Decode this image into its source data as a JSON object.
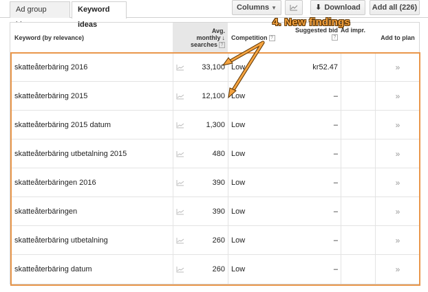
{
  "tabs": [
    {
      "label": "Ad group ideas"
    },
    {
      "label": "Keyword ideas"
    }
  ],
  "toolbar": {
    "columns_label": "Columns",
    "download_label": "Download",
    "add_all_label": "Add all (226)"
  },
  "table": {
    "headers": {
      "keyword": "Keyword (by relevance)",
      "avg_line1": "Avg.",
      "avg_line2": "monthly",
      "avg_line3": "searches",
      "competition": "Competition",
      "suggested_bid_line1": "Suggested bid",
      "impr_share": "Ad impr.",
      "add_to_plan": "Add to plan"
    },
    "rows": [
      {
        "keyword": "skatteåterbäring 2016",
        "avg": "33,100",
        "competition": "Low",
        "bid": "kr52.47",
        "add": "»"
      },
      {
        "keyword": "skatteåterbäring 2015",
        "avg": "12,100",
        "competition": "Low",
        "bid": "–",
        "add": "»"
      },
      {
        "keyword": "skatteåterbäring 2015 datum",
        "avg": "1,300",
        "competition": "Low",
        "bid": "–",
        "add": "»"
      },
      {
        "keyword": "skatteåterbäring utbetalning 2015",
        "avg": "480",
        "competition": "Low",
        "bid": "–",
        "add": "»"
      },
      {
        "keyword": "skatteåterbäringen 2016",
        "avg": "390",
        "competition": "Low",
        "bid": "–",
        "add": "»"
      },
      {
        "keyword": "skatteåterbäringen",
        "avg": "390",
        "competition": "Low",
        "bid": "–",
        "add": "»"
      },
      {
        "keyword": "skatteåterbäring utbetalning",
        "avg": "260",
        "competition": "Low",
        "bid": "–",
        "add": "»"
      },
      {
        "keyword": "skatteåterbäring datum",
        "avg": "260",
        "competition": "Low",
        "bid": "–",
        "add": "»"
      }
    ]
  },
  "annotation": {
    "text": "4. New findings",
    "color": "#f4a340"
  },
  "icons": {
    "trend": "line-chart-icon",
    "download": "download-icon",
    "help": "question-mark-icon"
  }
}
